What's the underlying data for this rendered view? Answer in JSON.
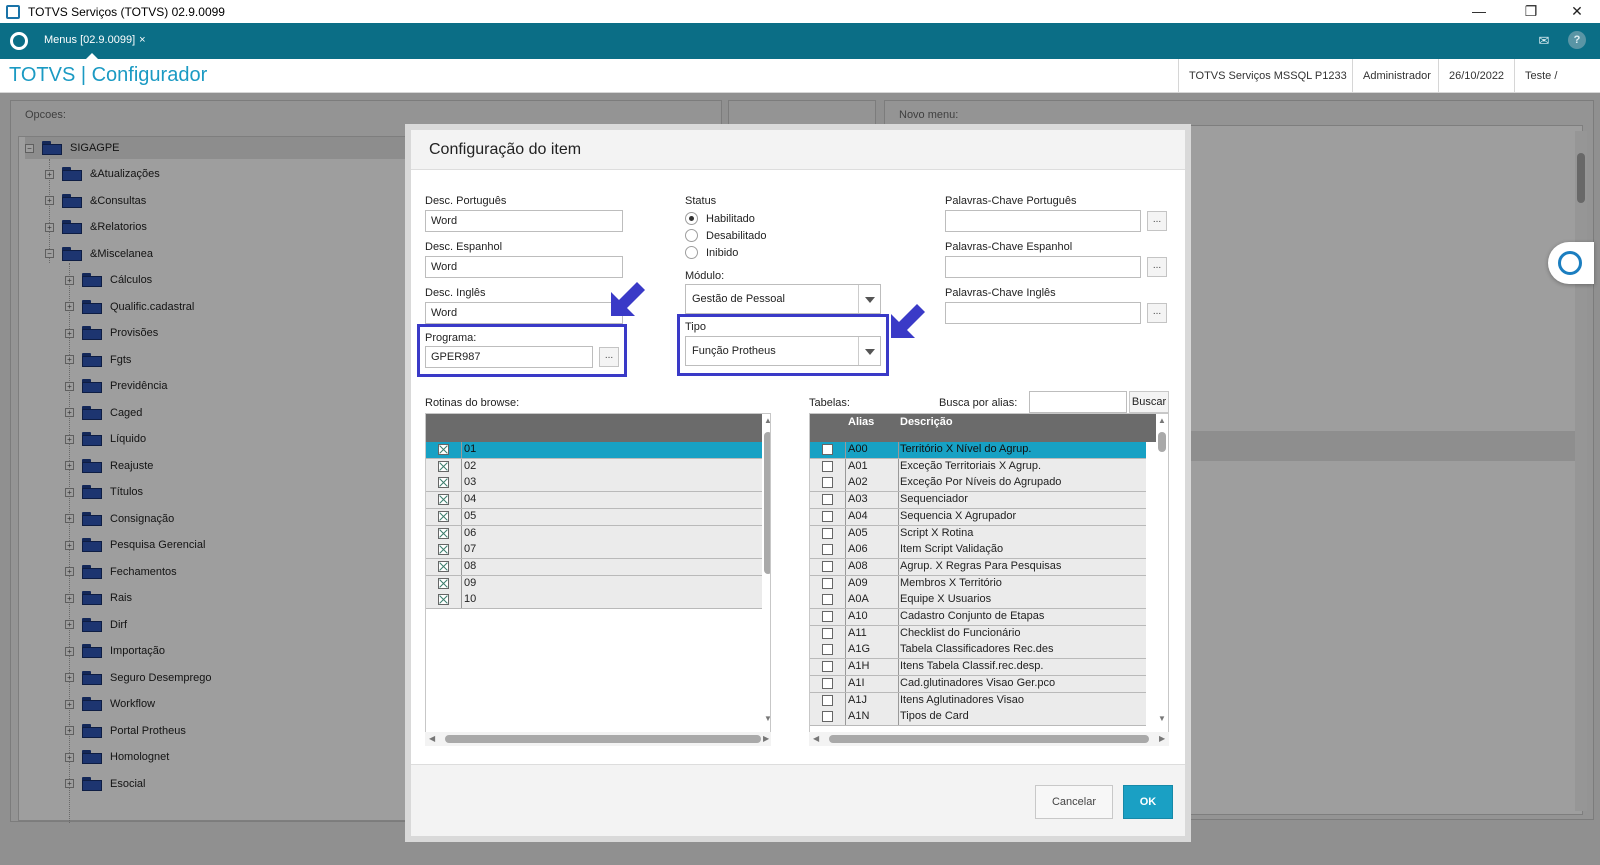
{
  "window": {
    "title": "TOTVS Serviços (TOTVS) 02.9.0099",
    "minimize": "—",
    "maximize": "❐",
    "close": "✕"
  },
  "tabbar": {
    "tab_label": "Menus [02.9.0099]",
    "tab_close": "×",
    "mail_icon": "envelope-icon",
    "help_icon": "?"
  },
  "header": {
    "brand": "TOTVS | Configurador",
    "server": "TOTVS Serviços MSSQL P1233",
    "user": "Administrador",
    "date": "26/10/2022",
    "company": "Teste / Matriz"
  },
  "background": {
    "opcoes_label": "Opcoes:",
    "novo_menu_label": "Novo menu:",
    "tree": {
      "root": "SIGAGPE",
      "level1": [
        "&Atualizações",
        "&Consultas",
        "&Relatorios",
        "&Miscelanea"
      ],
      "level2": [
        "Cálculos",
        "Qualific.cadastral",
        "Provisões",
        "Fgts",
        "Previdência",
        "Caged",
        "Líquido",
        "Reajuste",
        "Títulos",
        "Consignação",
        "Pesquisa Gerencial",
        "Fechamentos",
        "Rais",
        "Dirf",
        "Importação",
        "Seguro Desemprego",
        "Workflow",
        "Portal Protheus",
        "Homolognet",
        "Esocial"
      ]
    }
  },
  "dialog": {
    "title": "Configuração do item",
    "desc_pt_label": "Desc. Português",
    "desc_pt_value": "Word",
    "desc_es_label": "Desc. Espanhol",
    "desc_es_value": "Word",
    "desc_en_label": "Desc. Inglês",
    "desc_en_value": "Word",
    "programa_label": "Programa:",
    "programa_value": "GPER987",
    "dots": "...",
    "status_label": "Status",
    "status_options": [
      "Habilitado",
      "Desabilitado",
      "Inibido"
    ],
    "status_selected": "Habilitado",
    "modulo_label": "Módulo:",
    "modulo_value": "Gestão de Pessoal",
    "tipo_label": "Tipo",
    "tipo_value": "Função Protheus",
    "kw_pt_label": "Palavras-Chave Português",
    "kw_es_label": "Palavras-Chave Espanhol",
    "kw_en_label": "Palavras-Chave Inglês",
    "rotinas_label": "Rotinas do browse:",
    "rotinas": [
      {
        "num": "01",
        "checked": true
      },
      {
        "num": "02",
        "checked": true
      },
      {
        "num": "03",
        "checked": true
      },
      {
        "num": "04",
        "checked": true
      },
      {
        "num": "05",
        "checked": true
      },
      {
        "num": "06",
        "checked": true
      },
      {
        "num": "07",
        "checked": true
      },
      {
        "num": "08",
        "checked": true
      },
      {
        "num": "09",
        "checked": true
      },
      {
        "num": "10",
        "checked": true
      }
    ],
    "tabelas_label": "Tabelas:",
    "busca_label": "Busca por alias:",
    "buscar_button": "Buscar",
    "tabelas_headers": {
      "alias": "Alias",
      "descricao": "Descrição"
    },
    "tabelas": [
      {
        "alias": "A00",
        "desc": "Território X Nível do Agrup."
      },
      {
        "alias": "A01",
        "desc": "Exceção Territoriais X Agrup."
      },
      {
        "alias": "A02",
        "desc": "Exceção Por Níveis do Agrupado"
      },
      {
        "alias": "A03",
        "desc": "Sequenciador"
      },
      {
        "alias": "A04",
        "desc": "Sequencia X Agrupador"
      },
      {
        "alias": "A05",
        "desc": "Script X Rotina"
      },
      {
        "alias": "A06",
        "desc": "Item Script Validação"
      },
      {
        "alias": "A08",
        "desc": "Agrup. X Regras Para Pesquisas"
      },
      {
        "alias": "A09",
        "desc": "Membros X Território"
      },
      {
        "alias": "A0A",
        "desc": "Equipe X Usuarios"
      },
      {
        "alias": "A10",
        "desc": "Cadastro Conjunto de Etapas"
      },
      {
        "alias": "A11",
        "desc": "Checklist do Funcionário"
      },
      {
        "alias": "A1G",
        "desc": "Tabela Classificadores Rec.des"
      },
      {
        "alias": "A1H",
        "desc": "Itens Tabela Classif.rec.desp."
      },
      {
        "alias": "A1I",
        "desc": "Cad.glutinadores Visao Ger.pco"
      },
      {
        "alias": "A1J",
        "desc": "Itens Aglutinadores Visao"
      },
      {
        "alias": "A1N",
        "desc": "Tipos de Card"
      }
    ],
    "cancel_button": "Cancelar",
    "ok_button": "OK"
  },
  "colors": {
    "teal": "#0b6e86",
    "accent": "#17a1c4",
    "highlight_box": "#3a3ac7"
  }
}
